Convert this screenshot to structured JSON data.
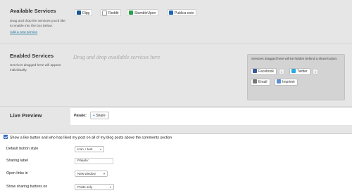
{
  "available": {
    "title": "Available Services",
    "description": "Drag and drop the services you'd like to enable into the box below.",
    "add_link": "Add a new service",
    "services": [
      {
        "label": "Digg",
        "icon": "digg-icon",
        "color": "#1b5790"
      },
      {
        "label": "Reddit",
        "icon": "reddit-icon",
        "color": "#ff4500"
      },
      {
        "label": "StumbleUpon",
        "icon": "stumbleupon-icon",
        "color": "#2aa24a"
      },
      {
        "label": "Publica esto",
        "icon": "publica-esto-icon",
        "color": "#1f66b5"
      }
    ]
  },
  "enabled": {
    "title": "Enabled Services",
    "description": "Services dragged here will appear individually.",
    "dropzone_text": "Drag and drop available services here"
  },
  "hidden": {
    "description": "Services dragged here will be hidden behind a share button.",
    "buttons": [
      {
        "label": "Facebook",
        "icon": "facebook-icon",
        "color": "#3b5998"
      },
      {
        "label": "Twitter",
        "icon": "twitter-icon",
        "color": "#29a9e1"
      },
      {
        "label": "Email",
        "icon": "email-icon",
        "color": "#777777"
      },
      {
        "label": "Imprimir",
        "icon": "print-icon",
        "color": "#5b8ed0"
      }
    ]
  },
  "preview": {
    "title": "Live Preview",
    "label": "Pásalo:",
    "share_button": "Share"
  },
  "options": {
    "like_checkbox_label": "Show a like button and who has liked my post on all of my blog posts above the comments section",
    "like_checked": true,
    "button_style_label": "Default button style",
    "button_style_value": "Icon + text",
    "sharing_label_label": "Sharing label",
    "sharing_label_value": "Pásalo:",
    "open_links_label": "Open links in",
    "open_links_value": "New window",
    "show_on_label": "Show sharing buttons on",
    "show_on_value": "Posts only"
  }
}
